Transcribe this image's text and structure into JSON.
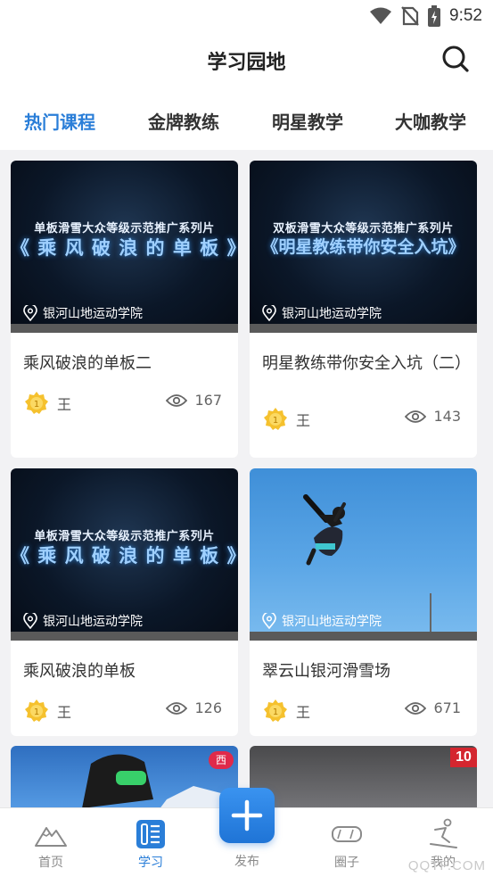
{
  "status_bar": {
    "time": "9:52"
  },
  "header": {
    "title": "学习园地"
  },
  "tabs": [
    {
      "label": "热门课程",
      "active": true
    },
    {
      "label": "金牌教练",
      "active": false
    },
    {
      "label": "明星教学",
      "active": false
    },
    {
      "label": "大咖教学",
      "active": false
    }
  ],
  "cards": [
    {
      "overlay_sub": "单板滑雪大众等级示范推广系列片",
      "overlay_main": "《 乘 风 破 浪 的 单 板 》",
      "location": "银河山地运动学院",
      "title": "乘风破浪的单板二",
      "author": "王",
      "views": "167"
    },
    {
      "overlay_sub": "双板滑雪大众等级示范推广系列片",
      "overlay_main": "《明星教练带你安全入坑》",
      "location": "银河山地运动学院",
      "title": "明星教练带你安全入坑（二）",
      "author": "王",
      "views": "143"
    },
    {
      "overlay_sub": "单板滑雪大众等级示范推广系列片",
      "overlay_main": "《 乘 风 破 浪 的 单 板 》",
      "location": "银河山地运动学院",
      "title": "乘风破浪的单板",
      "author": "王",
      "views": "126"
    },
    {
      "overlay_sub": "",
      "overlay_main": "",
      "location": "银河山地运动学院",
      "title": "翠云山银河滑雪场",
      "author": "王",
      "views": "671"
    }
  ],
  "peek_badges": {
    "left": "西",
    "right": "10"
  },
  "badge_text": "1",
  "bottom_nav": [
    {
      "label": "首页",
      "icon": "mountain-icon",
      "active": false
    },
    {
      "label": "学习",
      "icon": "study-icon",
      "active": true
    },
    {
      "label": "发布",
      "icon": "plus-icon",
      "active": false
    },
    {
      "label": "圈子",
      "icon": "goggles-icon",
      "active": false
    },
    {
      "label": "我的",
      "icon": "skier-icon",
      "active": false
    }
  ],
  "watermark": "QQTF.COM",
  "colors": {
    "accent": "#2a7ed8",
    "badge_gold": "#f5c12e"
  }
}
